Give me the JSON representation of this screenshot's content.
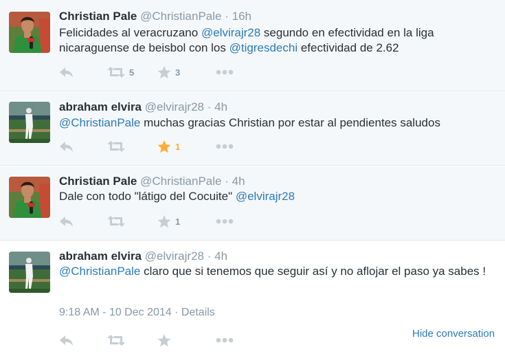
{
  "tweets": [
    {
      "fullname": "Christian Pale",
      "handle": "@ChristianPale",
      "time": "16h",
      "text": [
        {
          "t": "Felicidades al veracruzano "
        },
        {
          "t": "@elvirajr28",
          "m": true
        },
        {
          "t": " segundo en efectividad en la liga nicaraguense de beisbol con los "
        },
        {
          "t": "@tigresdechi",
          "m": true
        },
        {
          "t": " efectividad de 2.62"
        }
      ],
      "retweets": "5",
      "favorites": "3",
      "favorited": false
    },
    {
      "fullname": "abraham elvira",
      "handle": "@elvirajr28",
      "time": "4h",
      "text": [
        {
          "t": "@ChristianPale",
          "m": true
        },
        {
          "t": " muchas gracias Christian por estar al pendientes saludos"
        }
      ],
      "retweets": "",
      "favorites": "1",
      "favorited": true
    },
    {
      "fullname": "Christian Pale",
      "handle": "@ChristianPale",
      "time": "4h",
      "text": [
        {
          "t": "Dale con todo \"látigo del Cocuite\" "
        },
        {
          "t": "@elvirajr28",
          "m": true
        }
      ],
      "retweets": "",
      "favorites": "1",
      "favorited": false
    },
    {
      "fullname": "abraham elvira",
      "handle": "@elvirajr28",
      "time": "4h",
      "text": [
        {
          "t": "@ChristianPale",
          "m": true
        },
        {
          "t": " claro que si tenemos que seguir así y no aflojar el paso ya sabes !"
        }
      ],
      "retweets": "",
      "favorites": "",
      "favorited": false
    }
  ],
  "detail": {
    "timestamp": "9:18 AM - 10 Dec 2014",
    "separator": "·",
    "details_link": "Details"
  },
  "hide_conversation": "Hide conversation",
  "dot": "·",
  "icons": {
    "reply": "reply-icon",
    "retweet": "retweet-icon",
    "favorite": "star-icon",
    "more": "more-icon"
  },
  "colors": {
    "mention": "#2b7bb9",
    "muted": "#8899a6",
    "icon": "#c6cdd3",
    "favorite": "#ffac33",
    "shaded_bg": "#f5f8fa"
  }
}
